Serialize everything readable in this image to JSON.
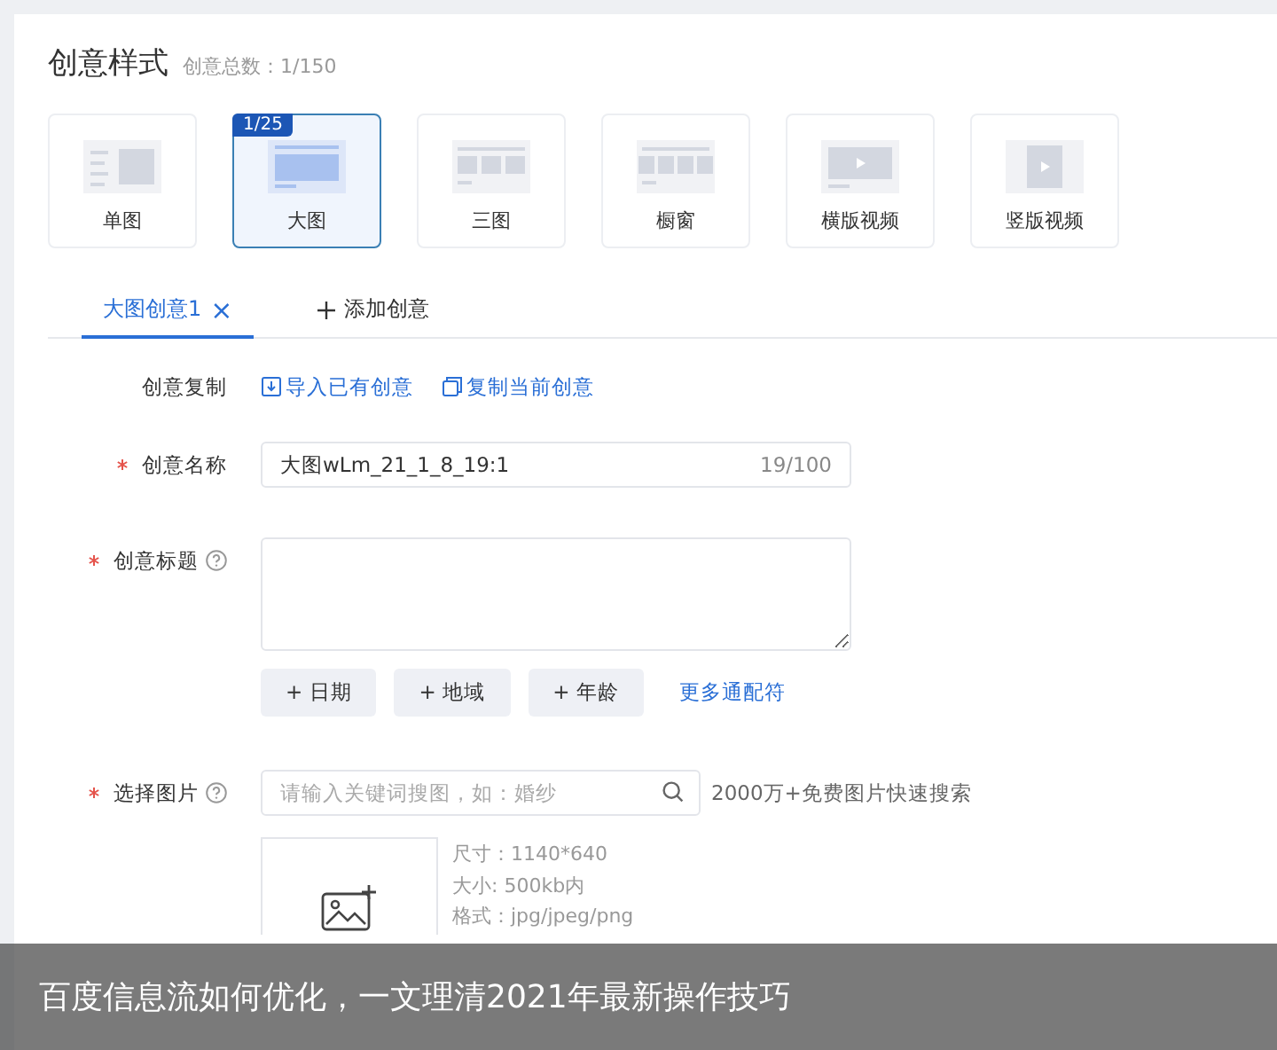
{
  "header": {
    "title": "创意样式",
    "count": "创意总数：1/150"
  },
  "styles": [
    {
      "label": "单图",
      "kind": "single",
      "selected": false
    },
    {
      "label": "大图",
      "kind": "large",
      "selected": true,
      "badge": "1/25"
    },
    {
      "label": "三图",
      "kind": "triple",
      "selected": false
    },
    {
      "label": "橱窗",
      "kind": "showcase",
      "selected": false
    },
    {
      "label": "横版视频",
      "kind": "hvideo",
      "selected": false
    },
    {
      "label": "竖版视频",
      "kind": "vvideo",
      "selected": false
    }
  ],
  "tabs": [
    {
      "label": "大图创意1",
      "kind": "tab",
      "close": "×",
      "selected": true
    },
    {
      "label": "添加创意",
      "kind": "add",
      "selected": false
    }
  ],
  "form": {
    "copy": {
      "label": "创意复制",
      "links": [
        {
          "label": "导入已有创意",
          "kind": "import"
        },
        {
          "label": "复制当前创意",
          "kind": "copy"
        }
      ]
    },
    "name": {
      "label": "创意名称",
      "required": true,
      "value": "大图wLm_21_1_8_19:1",
      "counter": "19/100"
    },
    "title": {
      "label": "创意标题",
      "required": true,
      "help": true,
      "chips": [
        "+ 日期",
        "+ 地域",
        "+ 年龄"
      ],
      "more": "更多通配符"
    },
    "image": {
      "label": "选择图片",
      "required": true,
      "help": true,
      "placeholder": "请输入关键词搜图，如：婚纱",
      "hint": "2000万+免费图片快速搜索",
      "specs": [
        "尺寸：1140*640",
        "大小: 500kb内",
        "格式：jpg/jpeg/png"
      ]
    }
  },
  "caption": "百度信息流如何优化，一文理清2021年最新操作技巧"
}
